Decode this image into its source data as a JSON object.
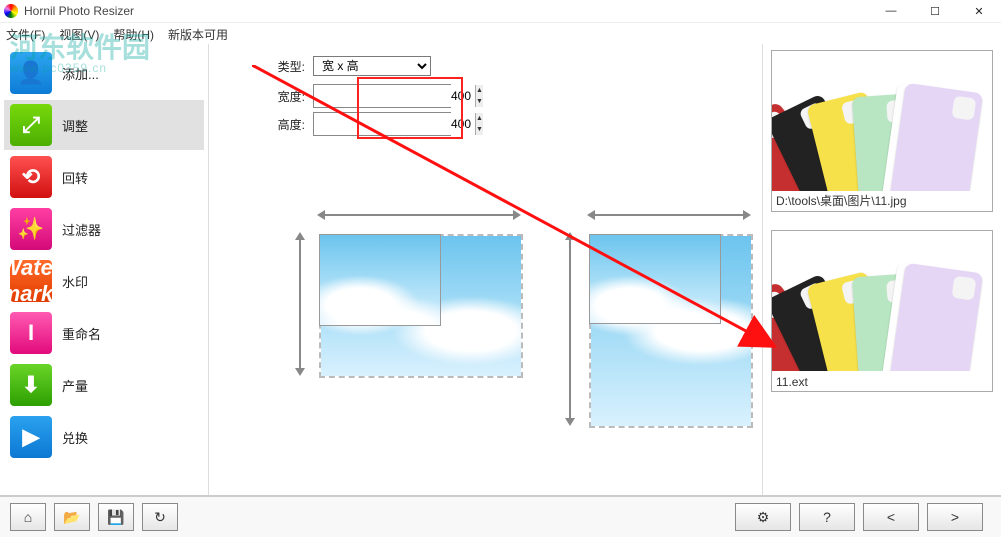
{
  "window": {
    "title": "Hornil Photo Resizer",
    "minimize": "—",
    "maximize": "☐",
    "close": "✕"
  },
  "menu": {
    "file": "文件(F)",
    "view": "视图(V)",
    "help": "帮助(H)",
    "updates": "新版本可用"
  },
  "watermark": {
    "main": "河东软件园",
    "sub": "www.pc0359.cn"
  },
  "sidebar": {
    "items": [
      {
        "label": "添加...",
        "icon": "add"
      },
      {
        "label": "调整",
        "icon": "resize"
      },
      {
        "label": "回转",
        "icon": "rotate"
      },
      {
        "label": "过滤器",
        "icon": "filter"
      },
      {
        "label": "水印",
        "icon": "watermark"
      },
      {
        "label": "重命名",
        "icon": "rename"
      },
      {
        "label": "产量",
        "icon": "output"
      },
      {
        "label": "兑换",
        "icon": "convert"
      }
    ],
    "selected_index": 1
  },
  "form": {
    "type_label": "类型:",
    "type_value": "宽 x 高",
    "width_label": "宽度:",
    "width_value": "400",
    "height_label": "高度:",
    "height_value": "400"
  },
  "previews": {
    "top_caption": "D:\\tools\\桌面\\图片\\11.jpg",
    "bottom_caption": "11.ext"
  },
  "footer": {
    "home": "⌂",
    "open": "📂",
    "save": "💾",
    "refresh": "↻",
    "gear": "⚙",
    "help": "?",
    "prev": "<",
    "next": ">"
  }
}
